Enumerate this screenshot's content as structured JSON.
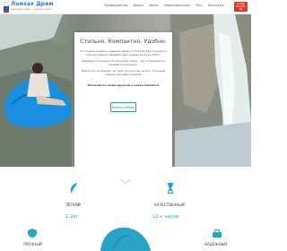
{
  "header": {
    "brand": "Ламзак Дрим",
    "tagline": "надувной диван · ленивый диван",
    "nav": [
      "Преимущества",
      "Видео",
      "Цвета",
      "Характеристики",
      "Тест",
      "Контакты"
    ],
    "phone": "8 800 100-00-00"
  },
  "hero": {
    "title": "Стильно. Компактно. Удобно.",
    "paragraphs": [
      "Это модная новинка - надувной диван в стиле lazy bag, пользуется спросом в Европе. Вмещает двух человек весом до 200 кг.",
      "Надувается в течение 20 секунд без помпы - просто раскройте и проведите по воздуху.",
      "Берите его на природу, на пляж, в поход или на дачу. Отличный подарок для себя и близких."
    ],
    "question": "Расскажете своим друзьям о новом ламзаке?",
    "button_label": "Купить сейчас"
  },
  "features": [
    {
      "label": "лёгкий",
      "value": "1,2кг"
    },
    {
      "label": "качественный",
      "value": "12+ часов"
    },
    {
      "label": "прочный",
      "value": ""
    },
    {
      "label": "надежный",
      "value": ""
    }
  ],
  "colors": {
    "accent": "#2aa3c9",
    "button_border": "#37a08a",
    "brand": "#2f7fc4",
    "bag_blue": "#1b8ee0",
    "phone_bg": "#d63b2f"
  },
  "icons": [
    "feather-icon",
    "clock-icon",
    "shield-icon",
    "bag-icon"
  ]
}
